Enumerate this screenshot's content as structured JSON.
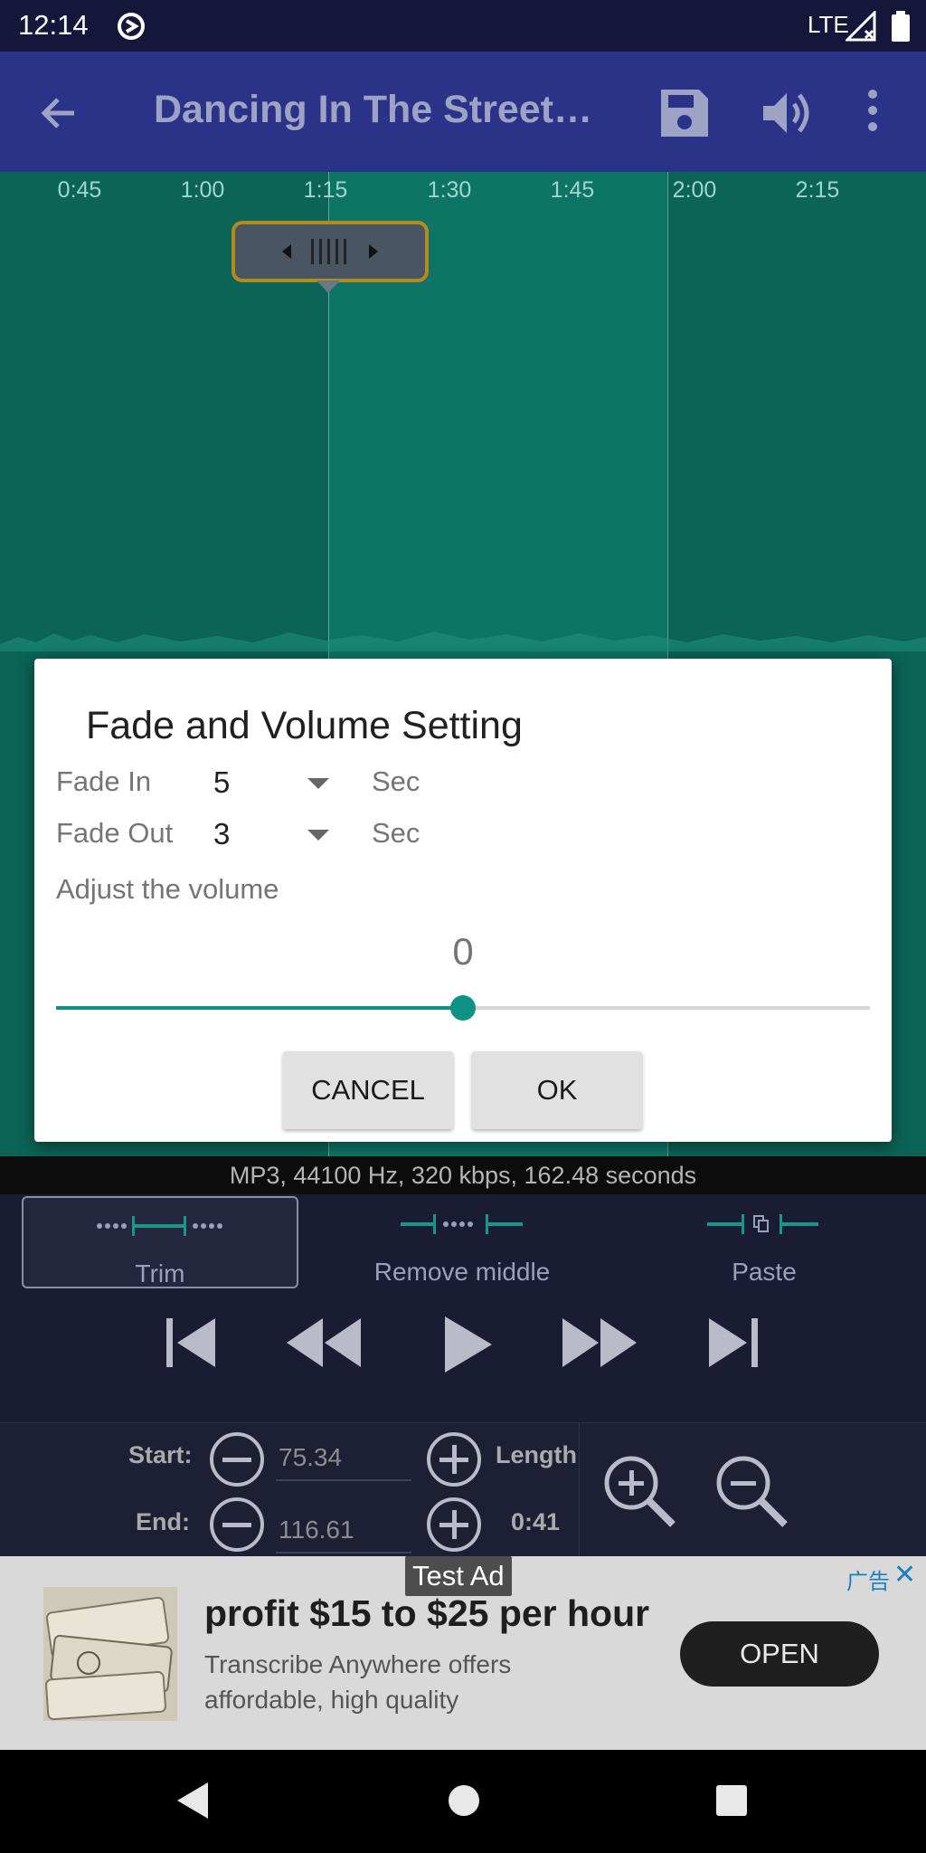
{
  "status_bar": {
    "time": "12:14",
    "network": "LTE"
  },
  "app_bar": {
    "title": "Dancing In The Street…"
  },
  "timeline": {
    "ticks": [
      "0:45",
      "1:00",
      "1:15",
      "1:30",
      "1:45",
      "2:00",
      "2:15"
    ]
  },
  "dialog": {
    "title": "Fade and Volume Setting",
    "fade_in_label": "Fade In",
    "fade_in_value": "5",
    "fade_out_label": "Fade Out",
    "fade_out_value": "3",
    "unit": "Sec",
    "adjust_label": "Adjust the volume",
    "volume_value": "0",
    "volume_slider_fraction": 0.5,
    "cancel_label": "CANCEL",
    "ok_label": "OK"
  },
  "file_info": "MP3, 44100 Hz, 320 kbps, 162.48 seconds",
  "tools": {
    "trim": "Trim",
    "remove_middle": "Remove middle",
    "paste": "Paste"
  },
  "edit": {
    "start_label": "Start:",
    "start_value": "75.34",
    "end_label": "End:",
    "end_value": "116.61",
    "length_label": "Length",
    "length_value": "0:41"
  },
  "ad": {
    "badge": "Test Ad",
    "adchoices": "广告",
    "headline": "profit $15 to $25 per hour",
    "body": "Transcribe Anywhere offers affordable, high quality",
    "cta": "OPEN"
  },
  "colors": {
    "app_bar": "#2a3388",
    "waveform": "#0b6455",
    "accent": "#0f9185",
    "panel": "#1a1c33"
  }
}
